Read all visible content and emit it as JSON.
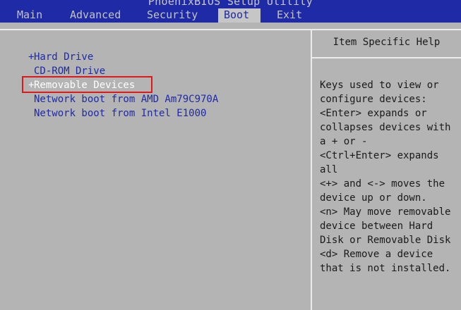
{
  "window": {
    "title": "PhoenixBIOS Setup Utility"
  },
  "menu": [
    {
      "label": "Main"
    },
    {
      "label": "Advanced"
    },
    {
      "label": "Security"
    },
    {
      "label": "Boot",
      "active": true
    },
    {
      "label": "Exit"
    }
  ],
  "boot_list": [
    {
      "prefix": "+",
      "label": "Hard Drive"
    },
    {
      "prefix": "",
      "label": "CD-ROM Drive"
    },
    {
      "prefix": "+",
      "label": "Removable Devices",
      "selected": true
    },
    {
      "prefix": "",
      "label": "Network boot from AMD Am79C970A"
    },
    {
      "prefix": "",
      "label": "Network boot from Intel E1000"
    }
  ],
  "help": {
    "title": "Item Specific Help",
    "lines": [
      "Keys used to view or",
      "configure devices:",
      "<Enter> expands or",
      "collapses devices with",
      "a + or -",
      "<Ctrl+Enter> expands",
      "all",
      "<+> and <-> moves the",
      "device up or down.",
      "<n> May move removable",
      "device between Hard",
      "Disk or Removable Disk",
      "<d> Remove a device",
      "that is not installed."
    ]
  },
  "colors": {
    "menubar_bg": "#1e2aa6",
    "panel_bg": "#b4b4b4",
    "item_text": "#1e2aa6",
    "selected_text": "#ffffff",
    "highlight_border": "#e01818"
  }
}
